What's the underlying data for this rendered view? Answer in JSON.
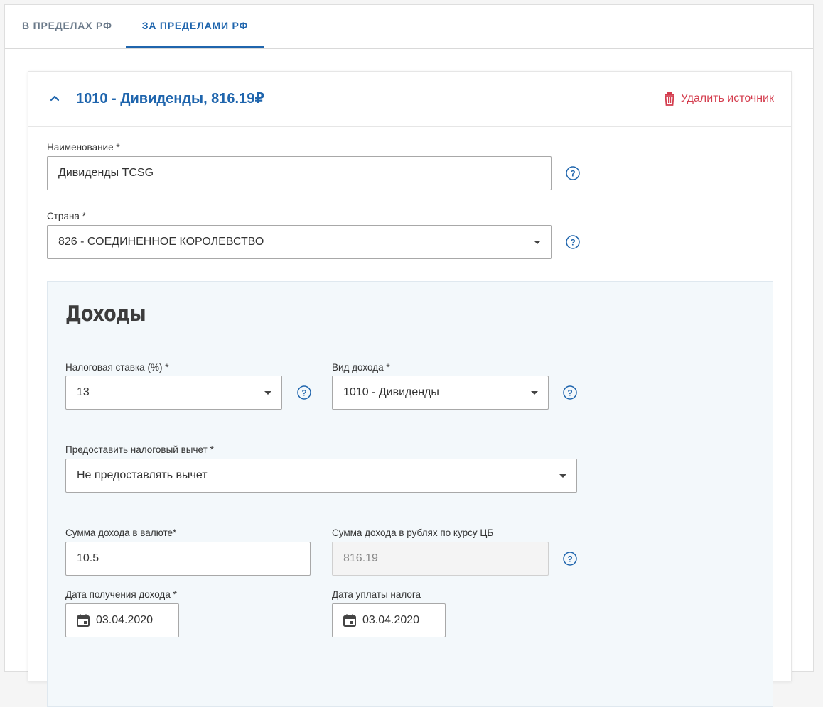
{
  "tabs": [
    {
      "label": "В ПРЕДЕЛАХ РФ",
      "active": false
    },
    {
      "label": "ЗА ПРЕДЕЛАМИ РФ",
      "active": true
    }
  ],
  "source": {
    "title": "1010 - Дивиденды, 816.19₽",
    "delete_label": "Удалить источник"
  },
  "form": {
    "name": {
      "label": "Наименование *",
      "value": "Дивиденды TCSG"
    },
    "country": {
      "label": "Страна *",
      "value": "826 - СОЕДИНЕННОЕ КОРОЛЕВСТВО"
    }
  },
  "income": {
    "title": "Доходы",
    "tax_rate": {
      "label": "Налоговая ставка (%) *",
      "value": "13"
    },
    "income_type": {
      "label": "Вид дохода *",
      "value": "1010 - Дивиденды"
    },
    "deduction": {
      "label": "Предоставить налоговый вычет *",
      "value": "Не предоставлять вычет"
    },
    "amount_currency": {
      "label": "Сумма дохода в валюте*",
      "value": "10.5"
    },
    "amount_rub": {
      "label": "Сумма дохода в рублях по курсу ЦБ",
      "value": "816.19"
    },
    "income_date": {
      "label": "Дата получения дохода *",
      "value": "03.04.2020"
    },
    "tax_date": {
      "label": "Дата уплаты налога",
      "value": "03.04.2020"
    }
  },
  "colors": {
    "accent": "#1f65ad",
    "danger": "#d43d4e",
    "panel_bg": "#f3f8fb"
  },
  "icons": [
    "chevron-up-icon",
    "trash-icon",
    "help-icon",
    "calendar-icon",
    "dropdown-caret-icon"
  ]
}
